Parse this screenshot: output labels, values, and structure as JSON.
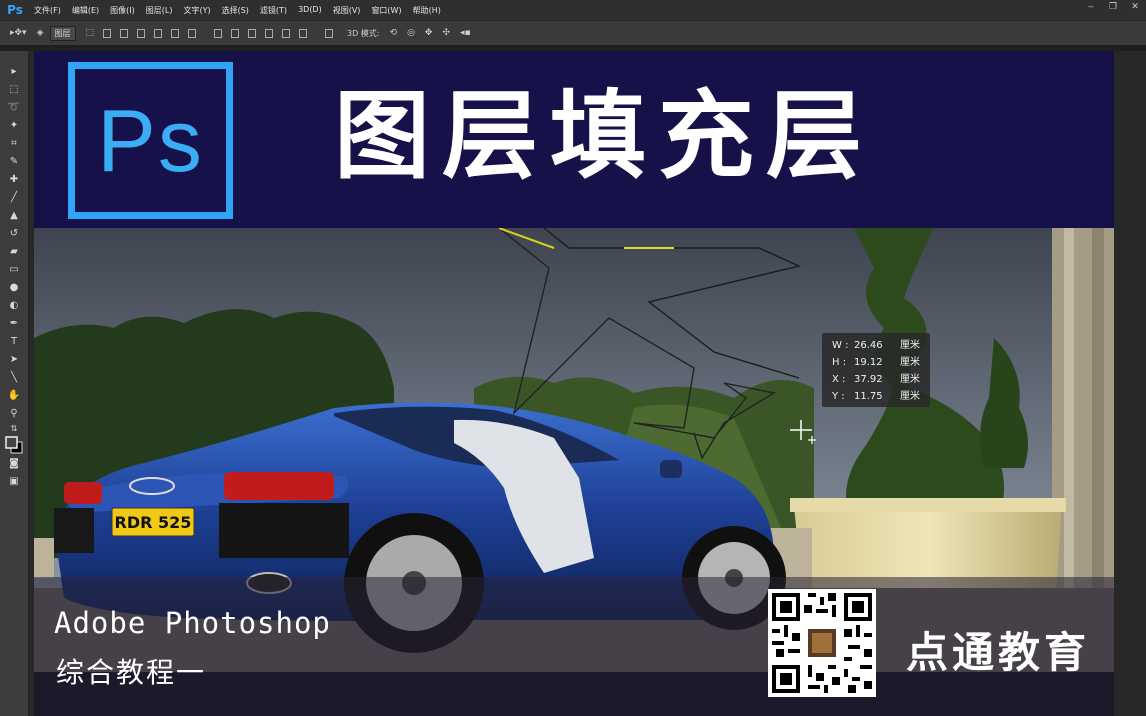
{
  "app": {
    "logo": "Ps"
  },
  "menu": [
    "文件(F)",
    "编辑(E)",
    "图像(I)",
    "图层(L)",
    "文字(Y)",
    "选择(S)",
    "滤镜(T)",
    "3D(D)",
    "视图(V)",
    "窗口(W)",
    "帮助(H)"
  ],
  "window_controls": [
    "minimize-icon",
    "restore-icon",
    "close-icon"
  ],
  "options": {
    "auto_select_value": "图层",
    "mode_label": "3D 模式:"
  },
  "banner": {
    "logo_text": "Ps",
    "title": "图层填充层"
  },
  "transform_info": [
    {
      "label": "W :",
      "value": "26.46",
      "unit": "厘米"
    },
    {
      "label": "H :",
      "value": "19.12",
      "unit": "厘米"
    },
    {
      "label": "X :",
      "value": "37.92",
      "unit": "厘米"
    },
    {
      "label": "Y :",
      "value": "11.75",
      "unit": "厘米"
    }
  ],
  "photo": {
    "plate": "RDR 525"
  },
  "footer": {
    "subtitle_en": "Adobe Photoshop",
    "subtitle_cn": "综合教程一",
    "brand": "点通教育"
  },
  "colors": {
    "banner_bg": "#17114a",
    "ps_blue": "#2fa6f5",
    "car_blue": "#1e3f8f"
  }
}
